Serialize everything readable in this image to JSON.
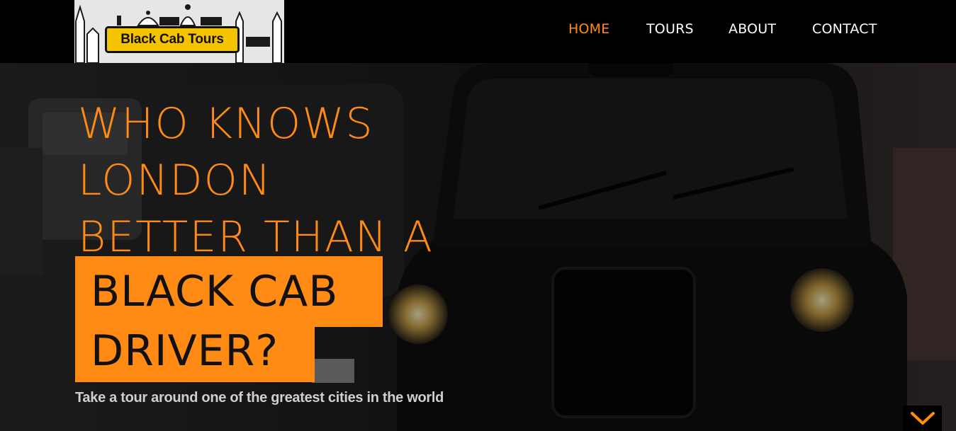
{
  "brand": {
    "logo_text": "Black Cab Tours"
  },
  "nav": {
    "items": [
      {
        "label": "HOME",
        "active": true
      },
      {
        "label": "TOURS",
        "active": false
      },
      {
        "label": "ABOUT",
        "active": false
      },
      {
        "label": "CONTACT",
        "active": false
      }
    ]
  },
  "hero": {
    "line1": "WHO KNOWS",
    "line2": "LONDON",
    "line3": "BETTER THAN A",
    "highlight1": "BLACK CAB",
    "highlight2": "DRIVER?",
    "tagline": "Take a tour around one of the greatest cities in the world",
    "scroll_icon": "chevron-down-icon"
  },
  "colors": {
    "accent": "#ff8a14",
    "header_bg": "#000000",
    "logo_plate": "#f5c400"
  }
}
